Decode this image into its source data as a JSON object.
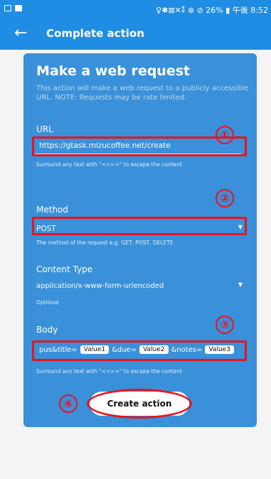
{
  "status_bar": {
    "right_text": "♀✱⊠✕⁑ ⊛ ⊘ 26% ▮ 午後 8:52"
  },
  "app_bar": {
    "title": "Complete action"
  },
  "card": {
    "title": "Make a web request",
    "description": "This action will make a web request to a publicly accessible URL. NOTE: Requests may be rate limited."
  },
  "url": {
    "label": "URL",
    "value": "https://gtask.mizucoffee.net/create",
    "hint": "Surround any text with \"<<>>\" to escape the content"
  },
  "method": {
    "label": "Method",
    "value": "POST",
    "hint": "The method of the request e.g. GET, POST, DELETE"
  },
  "content_type": {
    "label": "Content Type",
    "value": "application/x-www-form-urlencoded",
    "hint": "Optional"
  },
  "body": {
    "label": "Body",
    "part1": "pus&title=",
    "chip1": "Value1",
    "part2": "&due=",
    "chip2": "Value2",
    "part3": "&notes=",
    "chip3": "Value3",
    "hint": "Surround any text with \"<<>>\" to escape the content"
  },
  "create_button": {
    "label": "Create action"
  },
  "markers": [
    "①",
    "②",
    "③",
    "④"
  ],
  "colors": {
    "primary": "#1f8de3",
    "card": "#3a90d9",
    "annotation": "#e8141c"
  }
}
